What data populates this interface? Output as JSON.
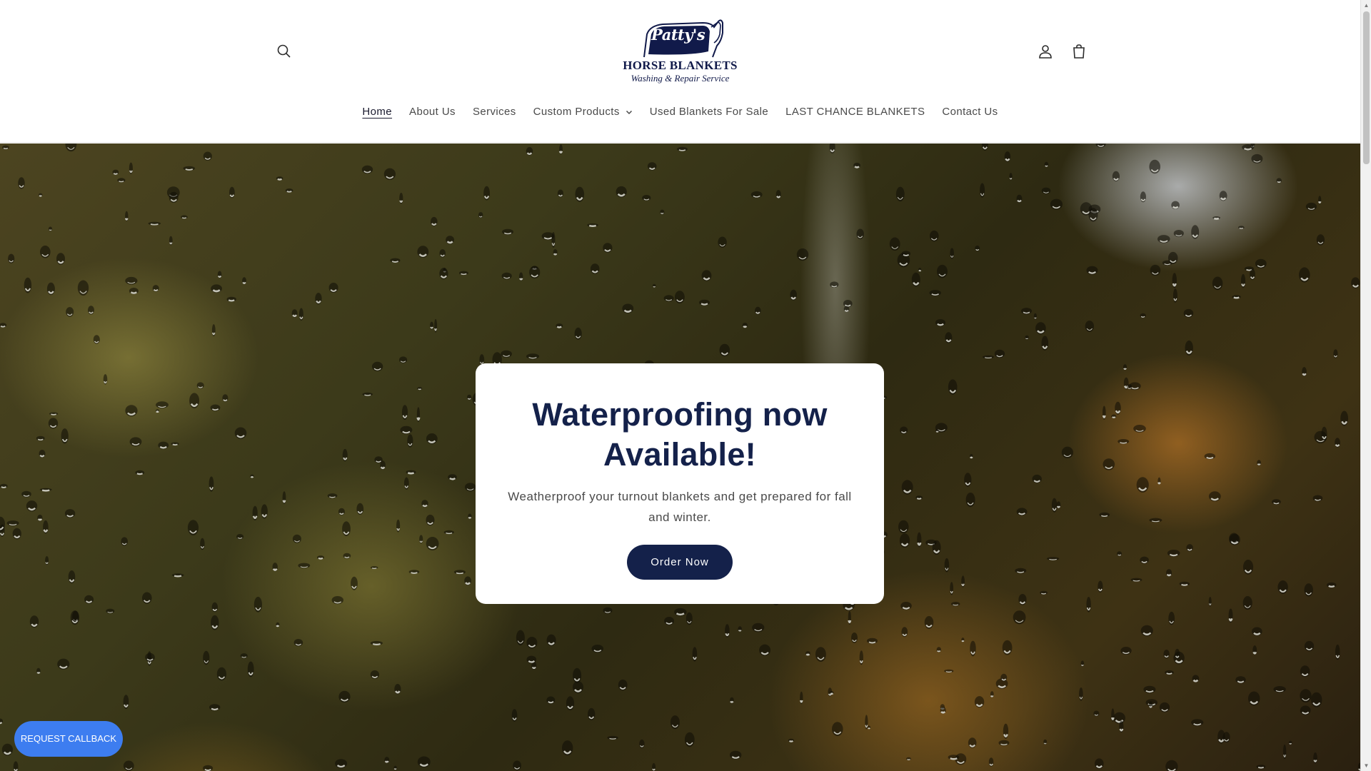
{
  "header": {
    "logo": {
      "name": "Patty's",
      "line1": "HORSE BLANKETS",
      "line2": "Washing & Repair Service"
    },
    "icons": {
      "search": "search-icon",
      "account": "account-icon",
      "cart": "cart-icon"
    }
  },
  "nav": {
    "items": [
      {
        "label": "Home",
        "active": true
      },
      {
        "label": "About Us"
      },
      {
        "label": "Services"
      },
      {
        "label": "Custom Products",
        "has_dropdown": true
      },
      {
        "label": "Used Blankets For Sale"
      },
      {
        "label": "LAST CHANCE BLANKETS"
      },
      {
        "label": "Contact Us"
      }
    ]
  },
  "hero": {
    "title": "Waterproofing now Available!",
    "text": "Weatherproof your turnout blankets and get prepared for fall and winter.",
    "button_label": "Order Now"
  },
  "callback": {
    "label": "REQUEST CALLBACK"
  },
  "colors": {
    "brand_navy": "#14214a",
    "callback_blue": "#3d7df0"
  }
}
